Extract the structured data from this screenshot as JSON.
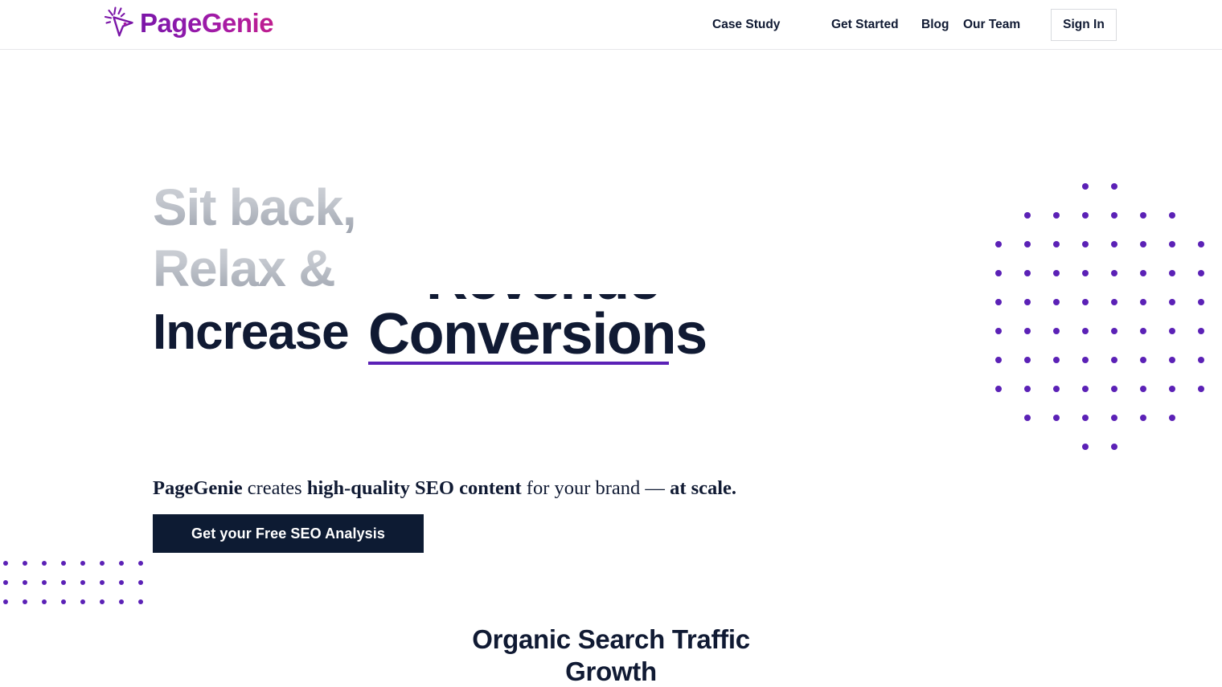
{
  "brand": {
    "name": "PageGenie",
    "icon": "magic-wand-cursor-icon",
    "gradient_from": "#7b16a8",
    "gradient_to": "#c01f8e"
  },
  "nav": {
    "links": [
      {
        "label": "Case Study"
      },
      {
        "label": "Get Started"
      },
      {
        "label": "Blog"
      },
      {
        "label": "Our Team"
      }
    ],
    "signin_label": "Sign In"
  },
  "hero": {
    "line1": "Sit back,",
    "line2": "Relax &",
    "line3_static": "Increase",
    "rotating_word": "Conversions",
    "rotating_word_previous": "Revenue",
    "underline_color": "#5b21b6",
    "subhead": {
      "part1": "PageGenie",
      "part2": " creates ",
      "part3": "high-quality SEO content",
      "part4": " for your brand — ",
      "part5": "at scale."
    },
    "cta_label": "Get your Free SEO Analysis",
    "cta_bg": "#0d1b33"
  },
  "decor": {
    "dot_color": "#5b21b6",
    "circle_dots": {
      "rows": 10,
      "cols": 8,
      "spacing": 36,
      "radius_cells": 4.6
    },
    "grid_dots": {
      "rows": 3,
      "cols": 8,
      "spacing": 24
    }
  },
  "section": {
    "heading_line1": "Organic Search Traffic",
    "heading_line2": "Growth"
  }
}
